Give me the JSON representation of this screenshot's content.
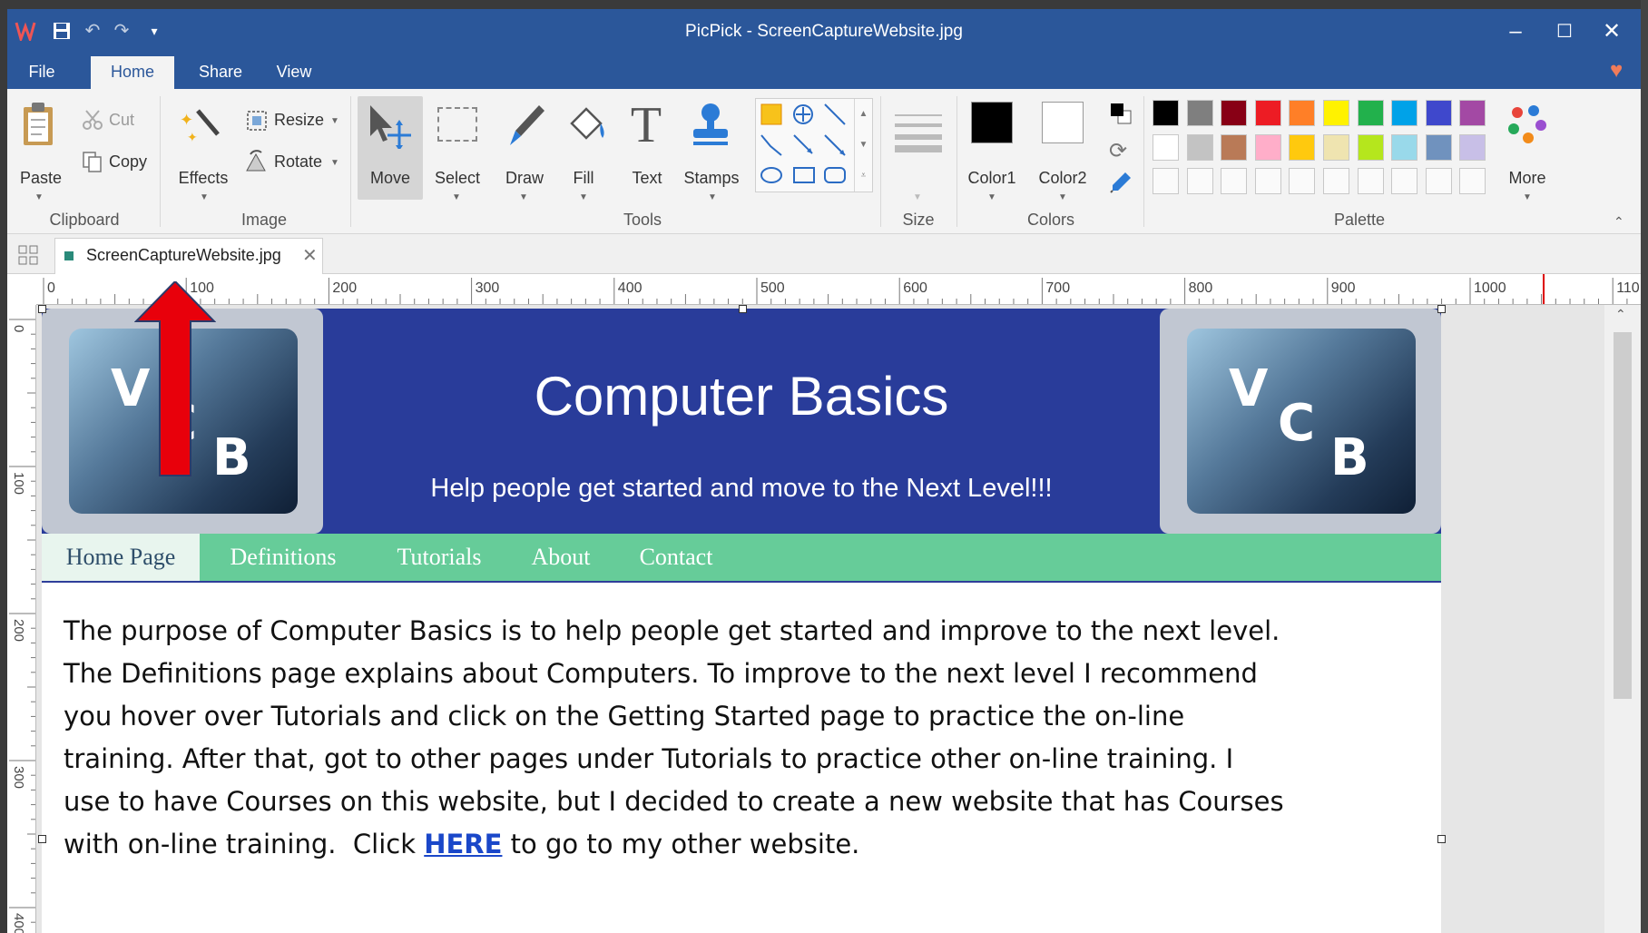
{
  "app": {
    "title": "PicPick - ScreenCaptureWebsite.jpg"
  },
  "ribbon_tabs": [
    "File",
    "Home",
    "Share",
    "View"
  ],
  "ribbon": {
    "clipboard": {
      "label": "Clipboard",
      "paste": "Paste",
      "cut": "Cut",
      "copy": "Copy"
    },
    "image": {
      "label": "Image",
      "effects": "Effects",
      "resize": "Resize",
      "rotate": "Rotate"
    },
    "tools": {
      "label": "Tools",
      "move": "Move",
      "select": "Select",
      "draw": "Draw",
      "fill": "Fill",
      "text": "Text",
      "stamps": "Stamps"
    },
    "size": {
      "label": "Size"
    },
    "colors": {
      "label": "Colors",
      "color1": "Color1",
      "color2": "Color2",
      "color1_value": "#000000",
      "color2_value": "#ffffff"
    },
    "palette": {
      "label": "Palette",
      "more": "More",
      "row1": [
        "#000000",
        "#7f7f7f",
        "#880015",
        "#ed1c24",
        "#ff7f27",
        "#fff200",
        "#22b14c",
        "#00a2e8",
        "#3f48cc",
        "#a349a4"
      ],
      "row2": [
        "#ffffff",
        "#c3c3c3",
        "#b97a57",
        "#ffaec9",
        "#ffc90e",
        "#efe4b0",
        "#b5e61d",
        "#99d9ea",
        "#7092be",
        "#c8bfe7"
      ]
    }
  },
  "document_tab": {
    "name": "ScreenCaptureWebsite.jpg"
  },
  "ruler": {
    "h_labels": [
      "0",
      "100",
      "200",
      "300",
      "400",
      "500",
      "600",
      "700",
      "800",
      "900",
      "1000",
      "110"
    ],
    "v_labels": [
      "0",
      "100",
      "200",
      "300",
      "400"
    ]
  },
  "website": {
    "logo_letters": [
      "V",
      "C",
      "B"
    ],
    "title": "Computer Basics",
    "subtitle": "Help people get started and move to the Next Level!!!",
    "nav": [
      "Home Page",
      "Definitions",
      "Tutorials",
      "About",
      "Contact"
    ],
    "paragraph_lines": [
      "The purpose of Computer Basics is to help people get started and improve to the next level.",
      "The Definitions page explains about Computers.  To improve to the next level I recommend",
      "you hover over Tutorials and click on the Getting Started page to practice the on-line",
      "training.  After that, got to other pages under Tutorials to practice other on-line training.  I",
      "use to have Courses on this website, but I decided to create a new website that has Courses"
    ],
    "last_line_before": "with on-line training.  Click ",
    "link_text": "HERE",
    "last_line_after": " to go to my other website."
  },
  "annotation": {
    "arrow_color": "#e8000b"
  },
  "colors": {
    "titlebar": "#2b579a",
    "header": "#293c9a",
    "nav": "#66cc99"
  }
}
